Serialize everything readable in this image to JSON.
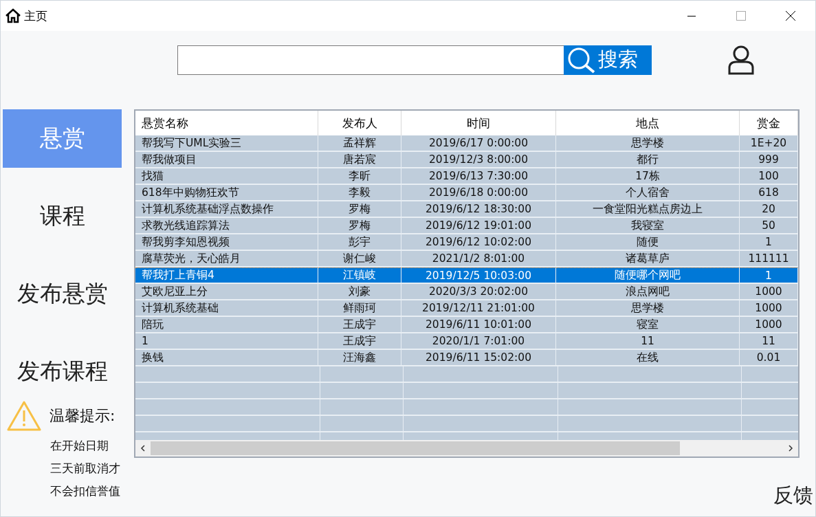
{
  "window": {
    "title": "主页"
  },
  "search": {
    "button": "搜索"
  },
  "sidebar": {
    "items": [
      {
        "label": "悬赏",
        "selected": true
      },
      {
        "label": "课程",
        "selected": false
      },
      {
        "label": "发布悬赏",
        "selected": false
      },
      {
        "label": "发布课程",
        "selected": false
      }
    ]
  },
  "tip": {
    "title": "温馨提示:",
    "lines": [
      "在开始日期",
      "三天前取消才",
      "不会扣信誉值"
    ]
  },
  "table": {
    "columns": [
      "悬赏名称",
      "发布人",
      "时间",
      "地点",
      "赏金"
    ],
    "rows": [
      {
        "cells": [
          "帮我写下UML实验三",
          "孟祥辉",
          "2019/6/17 0:00:00",
          "思学楼",
          "1E+20"
        ],
        "selected": false
      },
      {
        "cells": [
          "帮我做项目",
          "唐若宸",
          "2019/12/3 8:00:00",
          "都行",
          "999"
        ],
        "selected": false
      },
      {
        "cells": [
          "找猫",
          "李昕",
          "2019/6/13 7:30:00",
          "17栋",
          "100"
        ],
        "selected": false
      },
      {
        "cells": [
          "618年中购物狂欢节",
          "李毅",
          "2019/6/18 0:00:00",
          "个人宿舍",
          "618"
        ],
        "selected": false
      },
      {
        "cells": [
          "计算机系统基础浮点数操作",
          "罗梅",
          "2019/6/12 18:30:00",
          "一食堂阳光糕点房边上",
          "20"
        ],
        "selected": false
      },
      {
        "cells": [
          "求教光线追踪算法",
          "罗梅",
          "2019/6/12 19:01:00",
          "我寝室",
          "50"
        ],
        "selected": false
      },
      {
        "cells": [
          "帮我剪李知恩视频",
          "彭宇",
          "2019/6/12 10:02:00",
          "随便",
          "1"
        ],
        "selected": false
      },
      {
        "cells": [
          "腐草荧光，天心皓月",
          "谢仁峻",
          "2021/1/2 8:01:00",
          "诸葛草庐",
          "111111"
        ],
        "selected": false
      },
      {
        "cells": [
          "帮我打上青铜4",
          "江镇岐",
          "2019/12/5 10:03:00",
          "随便哪个网吧",
          "1"
        ],
        "selected": true
      },
      {
        "cells": [
          "艾欧尼亚上分",
          "刘豪",
          "2020/3/3 20:02:00",
          "浪点网吧",
          "1000"
        ],
        "selected": false
      },
      {
        "cells": [
          "计算机系统基础",
          "鲜雨珂",
          "2019/12/11 21:01:00",
          "思学楼",
          "1000"
        ],
        "selected": false
      },
      {
        "cells": [
          "陪玩",
          "王成宇",
          "2019/6/11 10:01:00",
          "寝室",
          "1000"
        ],
        "selected": false
      },
      {
        "cells": [
          "1",
          "王成宇",
          "2020/1/1 7:01:00",
          "11",
          "11"
        ],
        "selected": false
      },
      {
        "cells": [
          "换钱",
          "汪海鑫",
          "2019/6/11 15:02:00",
          "在线",
          "0.01"
        ],
        "selected": false
      }
    ]
  },
  "feedback": "反馈"
}
